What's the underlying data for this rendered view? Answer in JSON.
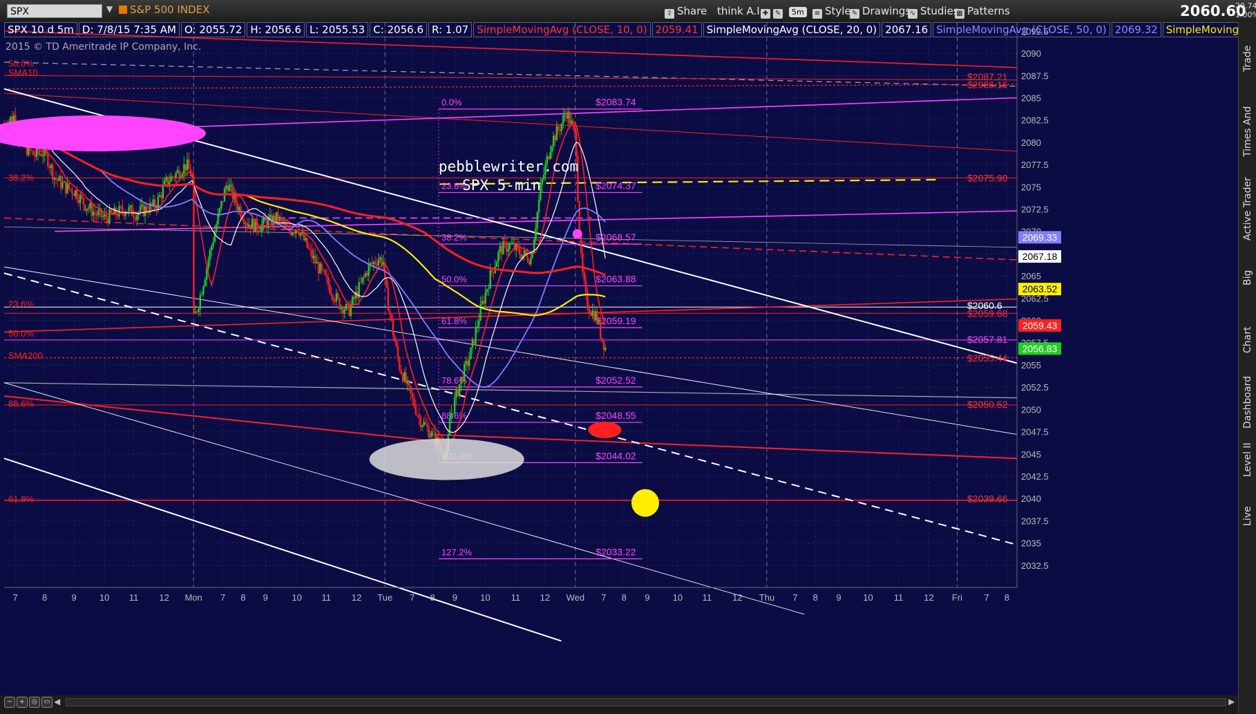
{
  "toolbar": {
    "symbol": "SPX",
    "instrument_name": "S&P 500 INDEX",
    "buttons": [
      {
        "key": "share",
        "label": "Share",
        "icon": "share-icon"
      },
      {
        "key": "thinkai",
        "label": "think A.I.",
        "icon": "lightbulb-icon"
      },
      {
        "key": "style",
        "label": "Style",
        "icon": "style-icon"
      },
      {
        "key": "drawings",
        "label": "Drawings",
        "icon": "pencil-icon"
      },
      {
        "key": "studies",
        "label": "Studies",
        "icon": "studies-icon"
      },
      {
        "key": "patterns",
        "label": "Patterns",
        "icon": "patterns-icon"
      }
    ],
    "timeframe": "5m",
    "last_price": "2060.60",
    "change": "-20.74",
    "change_pct": "-1.00%"
  },
  "infobar": {
    "items": [
      {
        "text": "SPX 10 d 5m",
        "color": "#ffffff"
      },
      {
        "text": "D: 7/8/15 7:35 AM",
        "color": "#ffffff"
      },
      {
        "text": "O: 2055.72",
        "color": "#ffffff"
      },
      {
        "text": "H: 2056.6",
        "color": "#ffffff"
      },
      {
        "text": "L: 2055.53",
        "color": "#ffffff"
      },
      {
        "text": "C: 2056.6",
        "color": "#ffffff"
      },
      {
        "text": "R: 1.07",
        "color": "#ffffff"
      },
      {
        "text": "SimpleMovingAvg (CLOSE, 10, 0)",
        "color": "#ff3030"
      },
      {
        "text": "2059.41",
        "color": "#ff3030"
      },
      {
        "text": "SimpleMovingAvg (CLOSE, 20, 0)",
        "color": "#ffffff"
      },
      {
        "text": "2067.16",
        "color": "#ffffff"
      },
      {
        "text": "SimpleMovingAvg (CLOSE, 50, 0)",
        "color": "#8888ff"
      },
      {
        "text": "2069.32",
        "color": "#8888ff"
      },
      {
        "text": "SimpleMoving...",
        "color": "#ffee00"
      }
    ]
  },
  "copyright": "2015 © TD Ameritrade IP Company, Inc.",
  "chart_data": {
    "type": "candlestick",
    "title": "pebblewriter.com",
    "subtitle": "SPX 5-min",
    "ylim": [
      2030,
      2093.5
    ],
    "y_ticks": [
      "2092.5",
      "2090",
      "2087.5",
      "2085",
      "2082.5",
      "2080",
      "2077.5",
      "2075",
      "2072.5",
      "2070",
      "2067.5",
      "2065",
      "2062.5",
      "2060",
      "2057.5",
      "2055",
      "2052.5",
      "2050",
      "2047.5",
      "2045",
      "2042.5",
      "2040",
      "2037.5",
      "2035",
      "2032.5"
    ],
    "x_ticks": [
      "7",
      "8",
      "9",
      "10",
      "11",
      "12",
      "Mon",
      "7",
      "8",
      "9",
      "10",
      "11",
      "12",
      "Tue",
      "7",
      "8",
      "9",
      "10",
      "11",
      "12",
      "Wed",
      "7",
      "8",
      "9",
      "10",
      "11",
      "12",
      "Thu",
      "7",
      "8",
      "9",
      "10",
      "11",
      "12",
      "Fri",
      "7",
      "8"
    ],
    "x_tick_fracs": [
      0.011,
      0.04,
      0.069,
      0.099,
      0.128,
      0.158,
      0.187,
      0.216,
      0.236,
      0.258,
      0.289,
      0.318,
      0.348,
      0.376,
      0.403,
      0.423,
      0.445,
      0.475,
      0.505,
      0.534,
      0.564,
      0.592,
      0.612,
      0.635,
      0.665,
      0.694,
      0.724,
      0.753,
      0.781,
      0.801,
      0.824,
      0.853,
      0.883,
      0.913,
      0.941,
      0.97,
      0.99
    ],
    "session_breaks_frac": [
      0.187,
      0.376,
      0.564,
      0.753,
      0.941
    ],
    "price_path": [
      [
        0.0,
        2082
      ],
      [
        0.01,
        2083
      ],
      [
        0.015,
        2080
      ],
      [
        0.03,
        2078.5
      ],
      [
        0.04,
        2079
      ],
      [
        0.05,
        2076
      ],
      [
        0.06,
        2075
      ],
      [
        0.07,
        2074.5
      ],
      [
        0.08,
        2073
      ],
      [
        0.09,
        2072
      ],
      [
        0.1,
        2071.5
      ],
      [
        0.11,
        2072
      ],
      [
        0.12,
        2072.5
      ],
      [
        0.13,
        2072
      ],
      [
        0.14,
        2072.5
      ],
      [
        0.15,
        2073
      ],
      [
        0.16,
        2075.5
      ],
      [
        0.17,
        2076.5
      ],
      [
        0.18,
        2077.5
      ],
      [
        0.186,
        2076
      ],
      [
        0.187,
        2060
      ],
      [
        0.192,
        2062
      ],
      [
        0.2,
        2066
      ],
      [
        0.21,
        2071
      ],
      [
        0.22,
        2075.5
      ],
      [
        0.23,
        2073
      ],
      [
        0.24,
        2071
      ],
      [
        0.25,
        2070.5
      ],
      [
        0.26,
        2071
      ],
      [
        0.27,
        2071.5
      ],
      [
        0.28,
        2070
      ],
      [
        0.29,
        2070.5
      ],
      [
        0.3,
        2068
      ],
      [
        0.31,
        2066
      ],
      [
        0.32,
        2064
      ],
      [
        0.33,
        2062
      ],
      [
        0.34,
        2061
      ],
      [
        0.35,
        2063.5
      ],
      [
        0.36,
        2066
      ],
      [
        0.37,
        2067
      ],
      [
        0.375,
        2066.5
      ],
      [
        0.376,
        2064
      ],
      [
        0.385,
        2058
      ],
      [
        0.39,
        2055
      ],
      [
        0.4,
        2052
      ],
      [
        0.41,
        2049
      ],
      [
        0.42,
        2047.5
      ],
      [
        0.43,
        2046
      ],
      [
        0.437,
        2044.5
      ],
      [
        0.44,
        2049
      ],
      [
        0.45,
        2053
      ],
      [
        0.46,
        2056
      ],
      [
        0.47,
        2061
      ],
      [
        0.48,
        2065
      ],
      [
        0.49,
        2068
      ],
      [
        0.5,
        2068.5
      ],
      [
        0.51,
        2067.5
      ],
      [
        0.52,
        2067
      ],
      [
        0.53,
        2075
      ],
      [
        0.54,
        2080
      ],
      [
        0.55,
        2082
      ],
      [
        0.555,
        2083.5
      ],
      [
        0.56,
        2082
      ],
      [
        0.563,
        2081
      ],
      [
        0.565,
        2079
      ],
      [
        0.567,
        2072
      ],
      [
        0.57,
        2066
      ],
      [
        0.575,
        2062
      ],
      [
        0.58,
        2061
      ],
      [
        0.585,
        2060.5
      ],
      [
        0.59,
        2058
      ],
      [
        0.595,
        2056.5
      ]
    ],
    "series": [
      {
        "name": "SimpleMovingAvg (CLOSE, 10, 0)",
        "color": "#ff2020"
      },
      {
        "name": "SimpleMovingAvg (CLOSE, 20, 0)",
        "color": "#ffffff"
      },
      {
        "name": "SimpleMovingAvg (CLOSE, 50, 0)",
        "color": "#7f7fff"
      },
      {
        "name": "SimpleMovingAvg",
        "color": "#ffee00"
      }
    ],
    "fib_levels": [
      {
        "label": "0.0%",
        "value": 2083.74,
        "price": "$2083.74"
      },
      {
        "label": "23.6%",
        "value": 2074.37,
        "price": "$2074.37"
      },
      {
        "label": "38.2%",
        "value": 2068.57,
        "price": "$2068.57"
      },
      {
        "label": "50.0%",
        "value": 2063.88,
        "price": "$2063.88"
      },
      {
        "label": "61.8%",
        "value": 2059.19,
        "price": "$2059.19"
      },
      {
        "label": "78.6%",
        "value": 2052.52,
        "price": "$2052.52"
      },
      {
        "label": "88.6%",
        "value": 2048.55,
        "price": "$2048.55"
      },
      {
        "label": "100.0%",
        "value": 2044.02,
        "price": "$2044.02"
      },
      {
        "label": "127.2%",
        "value": 2033.22,
        "price": "$2033.22"
      }
    ],
    "left_fib_labels": [
      {
        "label": "50.0%",
        "value": 2088.8
      },
      {
        "label": "SMA10",
        "value": 2087.8
      },
      {
        "label": "38.2%",
        "value": 2076
      },
      {
        "label": "23.6%",
        "value": 2061.8
      },
      {
        "label": "50.0%",
        "value": 2058.5
      },
      {
        "label": "SMA200",
        "value": 2056
      },
      {
        "label": "88.6%",
        "value": 2050.6
      },
      {
        "label": "61.8%",
        "value": 2039.9
      }
    ],
    "right_level_labels": [
      {
        "text": "$2087.21",
        "value": 2087.3,
        "color": "#ff3030"
      },
      {
        "text": "$2086.16",
        "value": 2086.4,
        "color": "#ff3030"
      },
      {
        "text": "$2075.90",
        "value": 2075.9,
        "color": "#ff3030"
      },
      {
        "text": "$2060.6",
        "value": 2061.6,
        "color": "#ffffff"
      },
      {
        "text": "$2059.68",
        "value": 2060.7,
        "color": "#ff3030"
      },
      {
        "text": "$2057.81",
        "value": 2057.8,
        "color": "#ff44ff"
      },
      {
        "text": "$2055.44",
        "value": 2055.7,
        "color": "#ff3030"
      },
      {
        "text": "$2050.52",
        "value": 2050.5,
        "color": "#ff3030"
      },
      {
        "text": "$2039.66",
        "value": 2039.9,
        "color": "#ff3030"
      }
    ],
    "price_badges": [
      {
        "text": "2069.33",
        "value": 2069.33,
        "bg": "#7f7fff",
        "fg": "#ffffff"
      },
      {
        "text": "2067.18",
        "value": 2067.18,
        "bg": "#ffffff",
        "fg": "#000000"
      },
      {
        "text": "2063.52",
        "value": 2063.52,
        "bg": "#ffee00",
        "fg": "#000000"
      },
      {
        "text": "2059.43",
        "value": 2059.43,
        "bg": "#ff2020",
        "fg": "#ffffff"
      },
      {
        "text": "2056.83",
        "value": 2056.83,
        "bg": "#22cc22",
        "fg": "#ffffff"
      }
    ],
    "colors": {
      "background": "#0c0c45",
      "candle_up": "#22cc22",
      "candle_down": "#ff2020",
      "grid": "#3a3a6a",
      "magenta": "#ff44ff",
      "red": "#ff2020",
      "yellow": "#ffee00",
      "white": "#ffffff",
      "grey": "#aaaaaa"
    }
  },
  "bottom_nav": {
    "buttons": [
      "zoom-out",
      "zoom-in",
      "fit",
      "settings"
    ]
  },
  "side_tabs": [
    "Trade",
    "Times And Sales",
    "Active Trader",
    "Big Buttons",
    "Chart",
    "Dashboard",
    "Level II",
    "Live News"
  ]
}
